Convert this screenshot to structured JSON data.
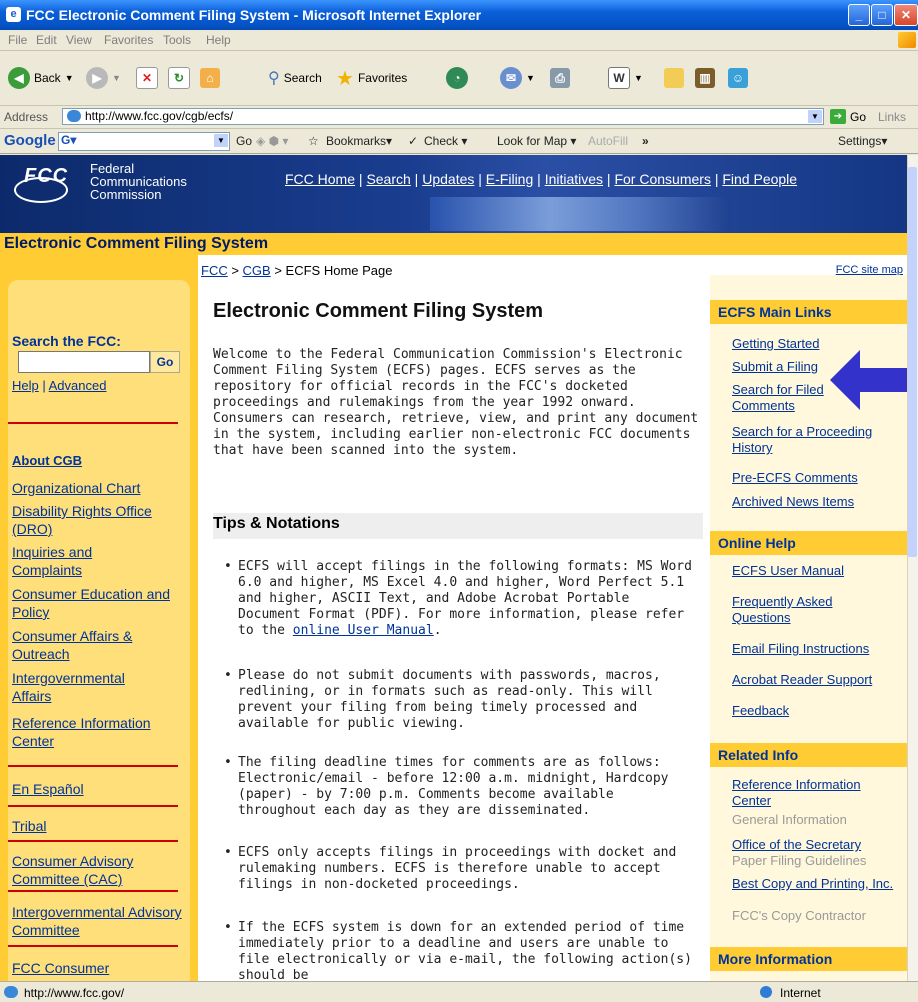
{
  "window": {
    "title": "FCC Electronic Comment Filing System - Microsoft Internet Explorer"
  },
  "menu": [
    "File",
    "Edit",
    "View",
    "Favorites",
    "Tools",
    "Help"
  ],
  "toolbar": {
    "back": "Back",
    "search": "Search",
    "favorites": "Favorites"
  },
  "address": {
    "label": "Address",
    "url": "http://www.fcc.gov/cgb/ecfs/",
    "go": "Go",
    "links": "Links"
  },
  "googlebar": {
    "logo": "Google",
    "go": "Go",
    "bookmarks": "Bookmarks▾",
    "check": "Check ▾",
    "lookformap": "Look for Map ▾",
    "autofill": "AutoFill",
    "settings": "Settings▾"
  },
  "header": {
    "logo": "FCC",
    "name_lines": [
      "Federal",
      "Communications",
      "Commission"
    ],
    "nav": [
      "FCC Home",
      "Search",
      "Updates",
      "E-Filing",
      "Initiatives",
      "For Consumers",
      "Find People"
    ],
    "band_title": "Electronic Comment Filing System"
  },
  "breadcrumb": {
    "fcc": "FCC",
    "cgb": "CGB",
    "current": "ECFS Home Page",
    "sitemap": "FCC site map"
  },
  "left": {
    "search_label": "Search the FCC:",
    "search_go": "Go",
    "help": "Help",
    "advanced": "Advanced",
    "about": "About CGB",
    "links": [
      "Organizational Chart",
      "Disability Rights Office (DRO)",
      "Inquiries and Complaints",
      "Consumer Education and Policy",
      "Consumer Affairs & Outreach",
      "Intergovernmental Affairs",
      "Reference Information Center"
    ],
    "links2": [
      "En Español",
      "Tribal",
      "Consumer Advisory Committee (CAC)",
      "Intergovernmental Advisory Committee",
      "FCC Consumer"
    ]
  },
  "main": {
    "title": "Electronic Comment Filing System",
    "welcome": "Welcome to the Federal Communication Commission's Electronic Comment Filing System (ECFS) pages. ECFS serves as the repository for official records in the FCC's docketed proceedings and rulemakings from the year 1992 onward. Consumers can research, retrieve, view, and print any document in the system, including earlier non-electronic FCC documents that have been scanned into the system.",
    "tips_heading": "Tips & Notations",
    "tip1": "ECFS will accept filings in the following formats: MS Word 6.0 and higher, MS Excel 4.0 and higher, Word Perfect 5.1 and higher, ASCII Text, and Adobe Acrobat Portable Document Format (PDF). For more information, please refer to the ",
    "tip1_link": "online User Manual",
    "tip2": "Please do not submit documents with passwords, macros, redlining, or in formats such as read-only. This will prevent your filing from being timely processed and available for public viewing.",
    "tip3": "The filing deadline times for comments are as follows: Electronic/email - before 12:00 a.m. midnight, Hardcopy (paper) - by 7:00 p.m. Comments become available throughout each day as they are disseminated.",
    "tip4": "ECFS only accepts filings in proceedings with docket and rulemaking numbers. ECFS is therefore unable to accept filings in non-docketed proceedings.",
    "tip5": "If the ECFS system is down for an extended period of time immediately prior to a deadline and users are unable to file electronically or via e-mail, the following action(s) should be"
  },
  "right": {
    "main_links_head": "ECFS Main Links",
    "main_links": [
      "Getting Started",
      "Submit a Filing",
      "Search for Filed Comments",
      "Search for a Proceeding History",
      "Pre-ECFS Comments",
      "Archived News Items"
    ],
    "help_head": "Online Help",
    "help_links": [
      "ECFS User Manual",
      "Frequently Asked Questions",
      "Email Filing Instructions",
      "Acrobat Reader Support",
      "Feedback"
    ],
    "related_head": "Related Info",
    "related": [
      {
        "link": "Reference Information Center",
        "sub": "General Information"
      },
      {
        "link": "Office of the Secretary",
        "sub": "Paper Filing Guidelines"
      },
      {
        "link": "Best Copy and Printing, Inc.",
        "sub": "FCC's Copy Contractor"
      }
    ],
    "more_head": "More Information"
  },
  "status": {
    "url": "http://www.fcc.gov/",
    "zone": "Internet"
  },
  "colors": {
    "gold": "#ffcc33",
    "link": "#003399",
    "arrow": "#3333cc"
  }
}
